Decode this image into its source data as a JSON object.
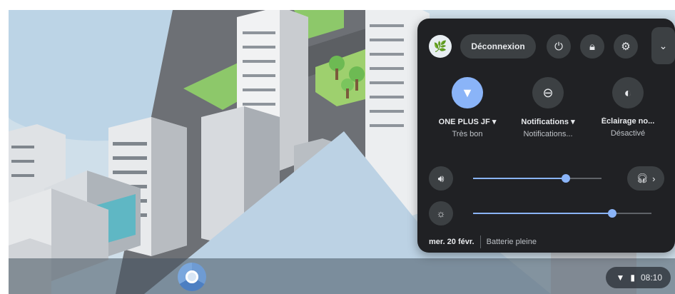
{
  "colors": {
    "panel_bg": "#202124",
    "button_bg": "#3c4043",
    "accent": "#8ab4f8",
    "sky": "#cfdfea"
  },
  "wallpaper": {
    "description_icon": "city-wallpaper"
  },
  "quick_settings": {
    "signout_label": "Déconnexion",
    "power_icon": "power-icon",
    "lock_icon": "lock-icon",
    "settings_icon": "gear-icon",
    "collapse_icon": "chevron-down-icon",
    "tiles": [
      {
        "icon": "wifi-icon",
        "label": "ONE PLUS JF",
        "sub": "Très bon",
        "on": true
      },
      {
        "icon": "do-not-disturb-icon",
        "label": "Notifications",
        "sub": "Notifications...",
        "on": false
      },
      {
        "icon": "night-light-icon",
        "label": "Éclairage no...",
        "sub": "Désactivé",
        "on": false
      }
    ],
    "volume": {
      "icon": "volume-icon",
      "level": 0.72
    },
    "brightness": {
      "icon": "brightness-icon",
      "level": 0.78
    },
    "audio_settings_icon": "headphones-icon",
    "date": "mer. 20 févr.",
    "battery": "Batterie pleine"
  },
  "shelf": {
    "launcher_icon": "chrome-icon",
    "time": "08:10"
  }
}
